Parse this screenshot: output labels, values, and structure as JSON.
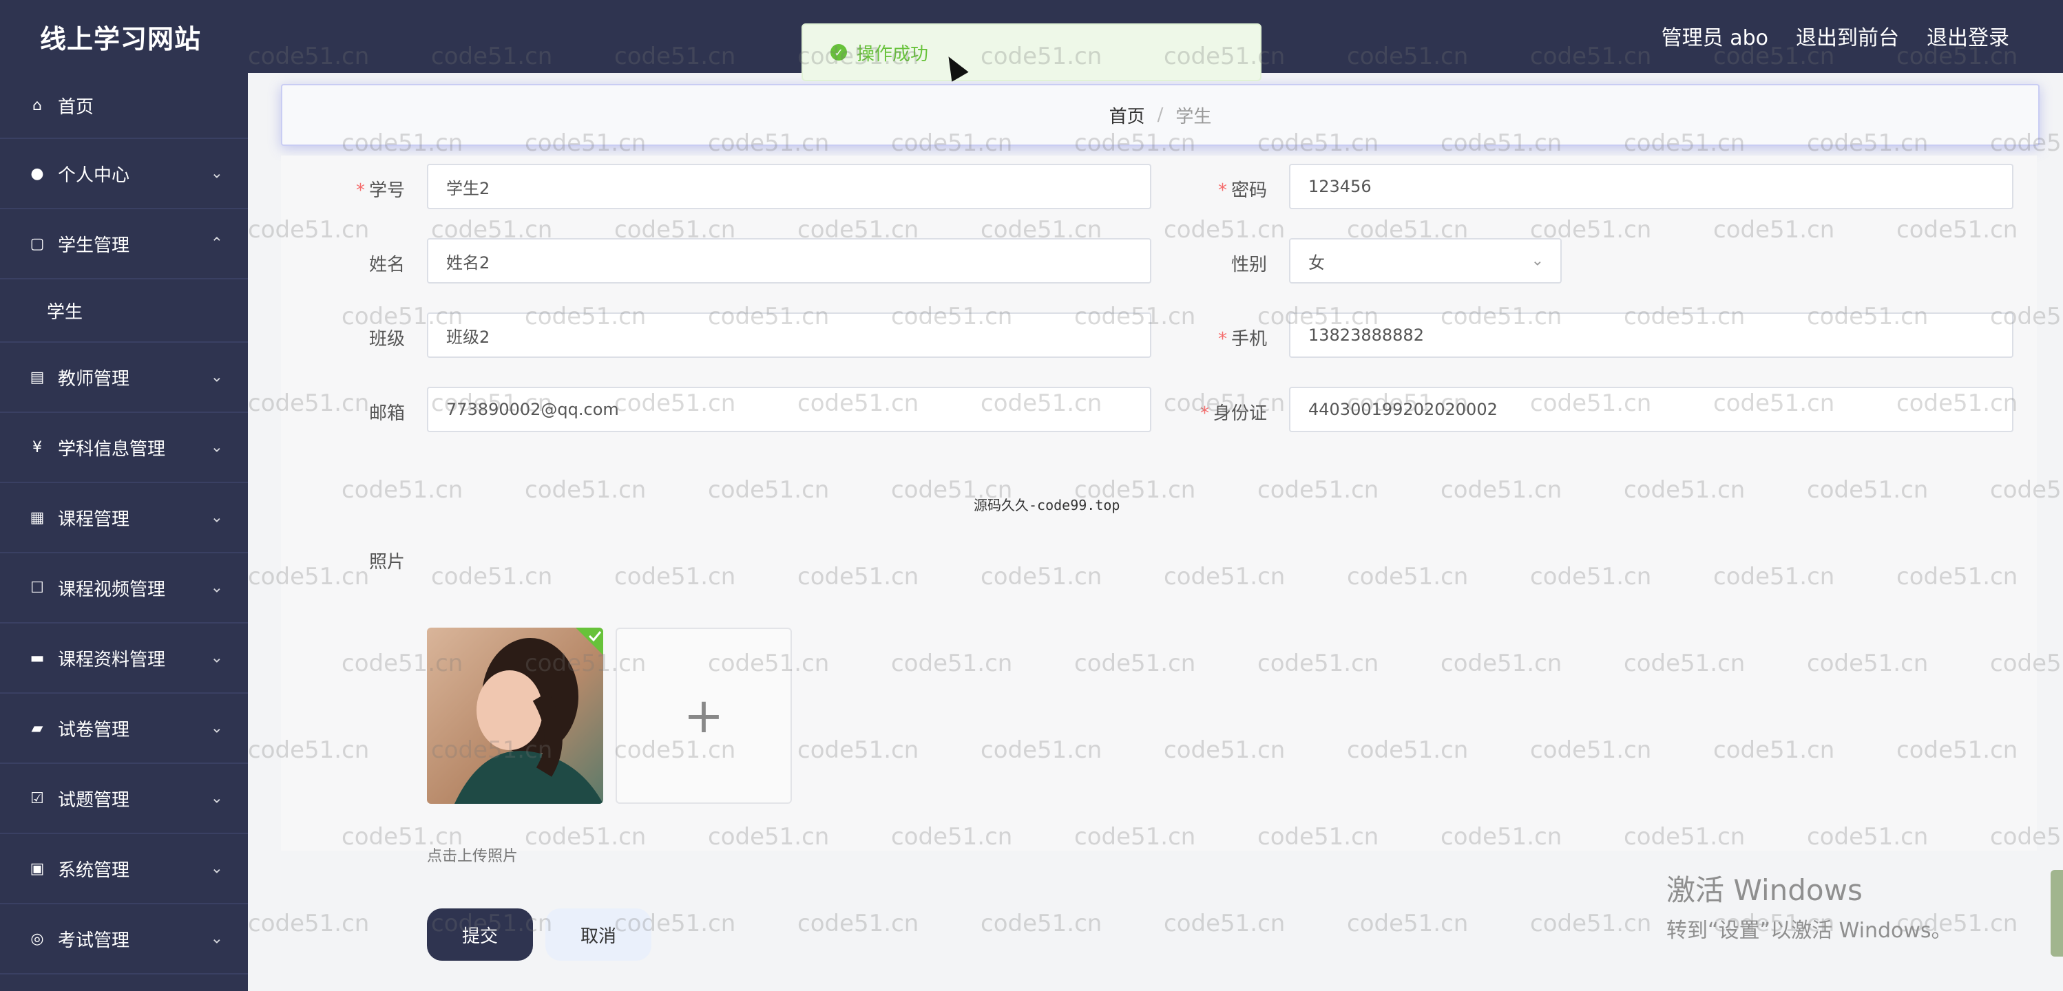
{
  "header": {
    "site_title": "线上学习网站",
    "admin_label": "管理员 abo",
    "to_frontend": "退出到前台",
    "logout": "退出登录"
  },
  "toast": {
    "message": "操作成功",
    "status": "success"
  },
  "sidebar": {
    "items": [
      {
        "label": "首页",
        "icon": "home-icon"
      },
      {
        "label": "个人中心",
        "icon": "user-icon"
      },
      {
        "label": "学生管理",
        "icon": "copy-icon",
        "expanded": true
      },
      {
        "label": "学生",
        "icon": "",
        "submenu": true
      },
      {
        "label": "教师管理",
        "icon": "clipboard-icon"
      },
      {
        "label": "学科信息管理",
        "icon": "finance-icon"
      },
      {
        "label": "课程管理",
        "icon": "grid-icon"
      },
      {
        "label": "课程视频管理",
        "icon": "chat-icon"
      },
      {
        "label": "课程资料管理",
        "icon": "folder-icon"
      },
      {
        "label": "试卷管理",
        "icon": "briefcase-icon"
      },
      {
        "label": "试题管理",
        "icon": "checklist-icon"
      },
      {
        "label": "系统管理",
        "icon": "monitor-icon"
      },
      {
        "label": "考试管理",
        "icon": "globe-icon"
      }
    ]
  },
  "breadcrumb": {
    "home": "首页",
    "current": "学生"
  },
  "form": {
    "student_id": {
      "label": "学号",
      "value": "学生2",
      "required": true
    },
    "password": {
      "label": "密码",
      "value": "123456",
      "required": true
    },
    "name": {
      "label": "姓名",
      "value": "姓名2",
      "required": false
    },
    "gender": {
      "label": "性别",
      "value": "女",
      "required": false
    },
    "class": {
      "label": "班级",
      "value": "班级2",
      "required": false
    },
    "phone": {
      "label": "手机",
      "value": "13823888882",
      "required": true
    },
    "email": {
      "label": "邮箱",
      "value": "773890002@qq.com",
      "required": false
    },
    "id_card": {
      "label": "身份证",
      "value": "440300199202020002",
      "required": true
    },
    "photo": {
      "label": "照片",
      "hint": "点击上传照片"
    },
    "submit": "提交",
    "cancel": "取消"
  },
  "overlay": {
    "center_text": "源码久久-code99.top",
    "watermark_text": "code51.cn",
    "activate_title": "激活 Windows",
    "activate_sub": "转到“设置”以激活 Windows。"
  },
  "colors": {
    "primary": "#2f3450",
    "success": "#67c23a",
    "required": "#f56c6c"
  }
}
